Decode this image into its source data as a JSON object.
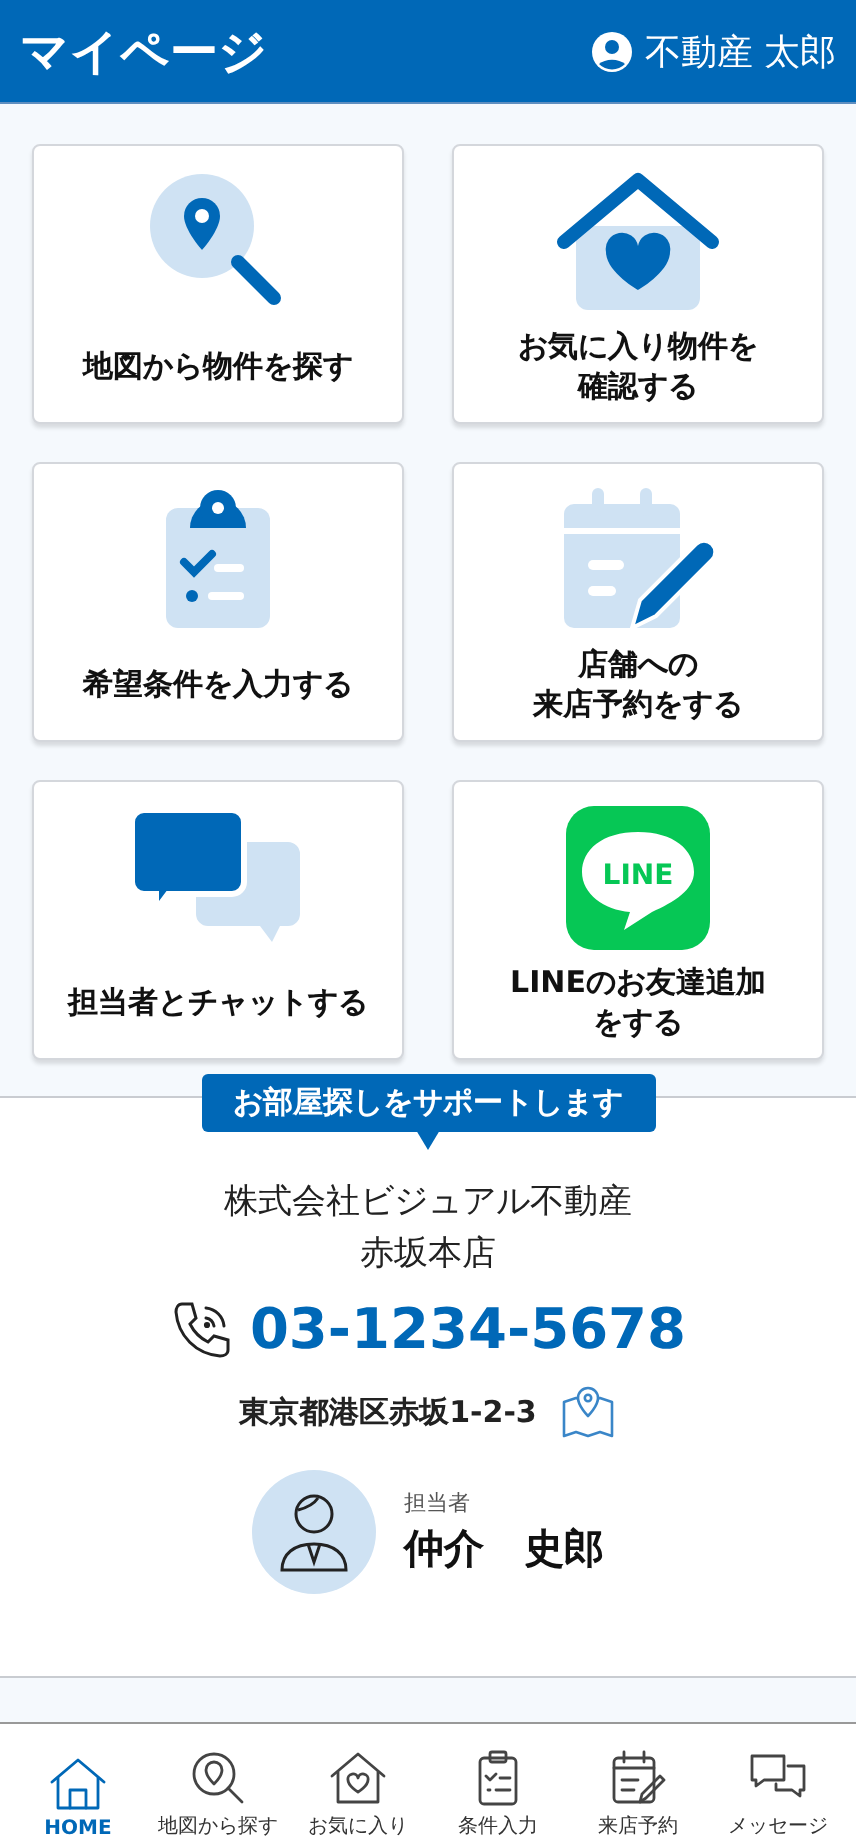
{
  "header": {
    "title": "マイページ",
    "user_name": "不動産 太郎"
  },
  "tiles": [
    {
      "kind": "map-search",
      "label_lines": [
        "地図から物件を探す"
      ]
    },
    {
      "kind": "house-heart",
      "label_lines": [
        "お気に入り物件を",
        "確認する"
      ]
    },
    {
      "kind": "clipboard",
      "label_lines": [
        "希望条件を入力する"
      ]
    },
    {
      "kind": "calendar-pen",
      "label_lines": [
        "店舗への",
        "来店予約をする"
      ]
    },
    {
      "kind": "chat",
      "label_lines": [
        "担当者とチャットする"
      ]
    },
    {
      "kind": "line",
      "label_lines": [
        "LINEのお友達追加",
        "をする"
      ],
      "logo_text": "LINE"
    }
  ],
  "support": {
    "badge": "お部屋探しをサポートします",
    "company": "株式会社ビジュアル不動産",
    "branch": "赤坂本店",
    "phone": "03-1234-5678",
    "address": "東京都港区赤坂1-2-3",
    "staff_label": "担当者",
    "staff_name": "仲介　史郎"
  },
  "nav": [
    {
      "kind": "home",
      "label": "HOME",
      "selected": true
    },
    {
      "kind": "map-search",
      "label": "地図から探す",
      "selected": false
    },
    {
      "kind": "house-heart",
      "label": "お気に入り",
      "selected": false
    },
    {
      "kind": "clipboard",
      "label": "条件入力",
      "selected": false
    },
    {
      "kind": "calendar-pen",
      "label": "来店予約",
      "selected": false
    },
    {
      "kind": "chat",
      "label": "メッセージ",
      "selected": false
    }
  ]
}
